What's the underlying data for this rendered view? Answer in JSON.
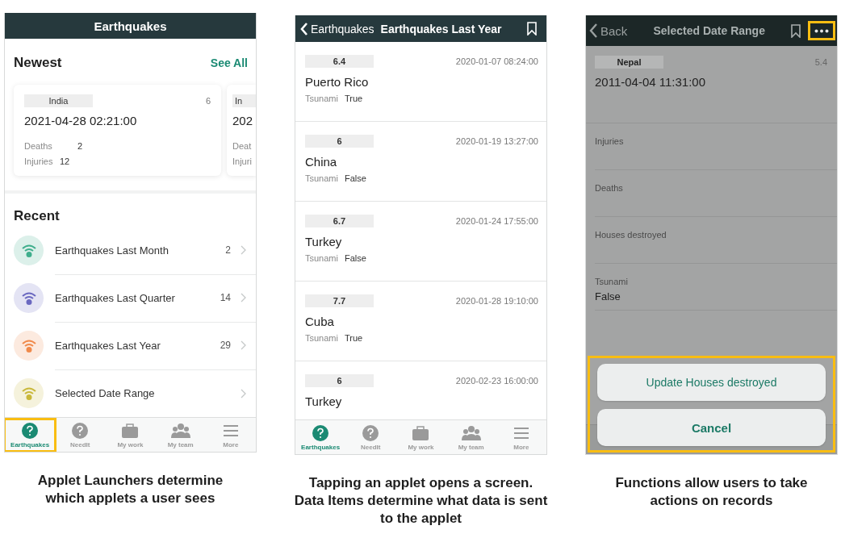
{
  "screen_1": {
    "header": {
      "title": "Earthquakes"
    },
    "newest": {
      "title": "Newest",
      "link": "See All",
      "cards": [
        {
          "country": "India",
          "magnitude": "6",
          "datetime": "2021-04-28 02:21:00",
          "fields": [
            {
              "label": "Deaths",
              "value": "2"
            },
            {
              "label": "Injuries",
              "value": "12"
            }
          ]
        },
        {
          "country": "In",
          "datetime": "202",
          "fields": [
            {
              "label": "Deat"
            },
            {
              "label": "Injuri"
            }
          ]
        }
      ]
    },
    "recent": {
      "title": "Recent",
      "items": [
        {
          "label": "Earthquakes Last Month",
          "count": "2",
          "color": "#3fae8c"
        },
        {
          "label": "Earthquakes Last Quarter",
          "count": "14",
          "color": "#6a68c0"
        },
        {
          "label": "Earthquakes Last Year",
          "count": "29",
          "color": "#f08a4b"
        },
        {
          "label": "Selected Date Range",
          "color": "#c9b83a"
        }
      ]
    },
    "tabs": [
      {
        "label": "Earthquakes",
        "selected": true,
        "highlighted": true
      },
      {
        "label": "NeedIt",
        "selected": false,
        "highlighted": false
      },
      {
        "label": "My work",
        "selected": false,
        "highlighted": false
      },
      {
        "label": "My team",
        "selected": false,
        "highlighted": false
      },
      {
        "label": "More",
        "selected": false,
        "highlighted": false
      }
    ]
  },
  "screen_2": {
    "header": {
      "back": "Earthquakes",
      "title": "Earthquakes Last Year"
    },
    "records": [
      {
        "magnitude": "6.4",
        "datetime": "2020-01-07 08:24:00",
        "place": "Puerto Rico",
        "tsunami_label": "Tsunami",
        "tsunami": "True"
      },
      {
        "magnitude": "6",
        "datetime": "2020-01-19 13:27:00",
        "place": "China",
        "tsunami_label": "Tsunami",
        "tsunami": "False"
      },
      {
        "magnitude": "6.7",
        "datetime": "2020-01-24 17:55:00",
        "place": "Turkey",
        "tsunami_label": "Tsunami",
        "tsunami": "False"
      },
      {
        "magnitude": "7.7",
        "datetime": "2020-01-28 19:10:00",
        "place": "Cuba",
        "tsunami_label": "Tsunami",
        "tsunami": "True"
      },
      {
        "magnitude": "6",
        "datetime": "2020-02-23 16:00:00",
        "place": "Turkey"
      }
    ],
    "tabs": [
      {
        "label": "Earthquakes",
        "selected": true
      },
      {
        "label": "NeedIt",
        "selected": false
      },
      {
        "label": "My work",
        "selected": false
      },
      {
        "label": "My team",
        "selected": false
      },
      {
        "label": "More",
        "selected": false
      }
    ]
  },
  "screen_3": {
    "header": {
      "back": "Back",
      "title": "Selected Date Range",
      "more_highlighted": true
    },
    "record": {
      "country": "Nepal",
      "magnitude": "5.4",
      "datetime": "2011-04-04 11:31:00"
    },
    "fields": [
      {
        "label": "Injuries"
      },
      {
        "label": "Deaths"
      },
      {
        "label": "Houses destroyed"
      },
      {
        "label": "Tsunami",
        "value": "False"
      }
    ],
    "action_sheet": {
      "highlighted": true,
      "actions": [
        {
          "label": "Update Houses destroyed",
          "kind": "action"
        },
        {
          "label": "Cancel",
          "kind": "cancel"
        }
      ]
    }
  },
  "captions": [
    "Applet Launchers determine which applets a user sees",
    "Tapping an applet opens a screen. Data Items determine what data is sent to the applet",
    "Functions allow users to take actions on records"
  ]
}
